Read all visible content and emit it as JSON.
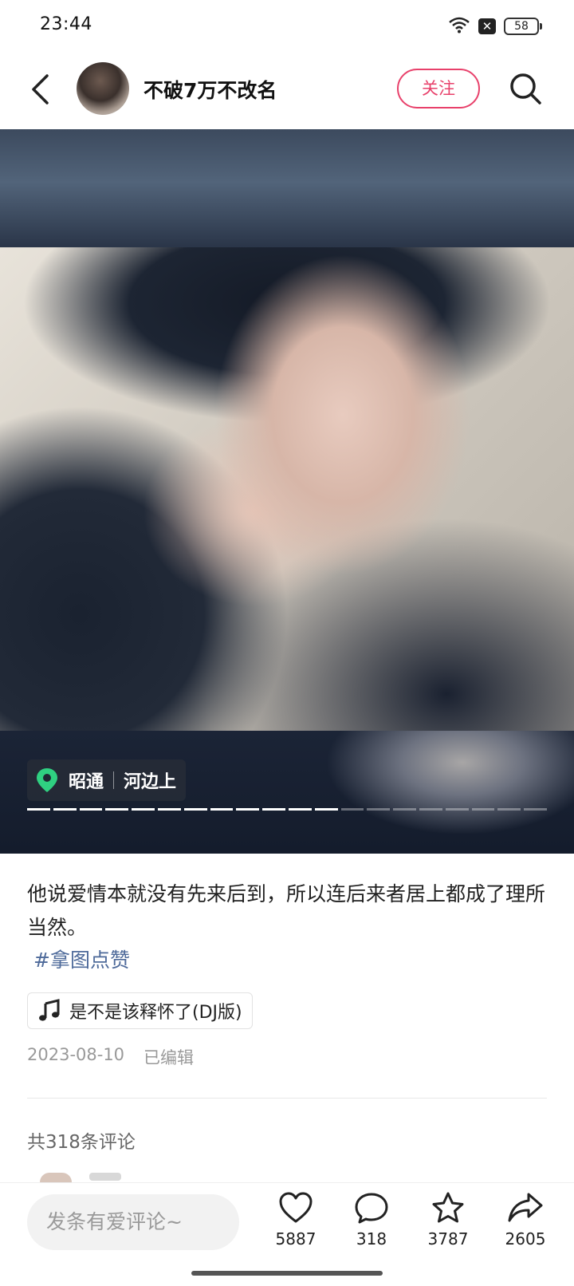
{
  "status_bar": {
    "time": "23:44",
    "battery": "58"
  },
  "header": {
    "username": "不破7万不改名",
    "follow_label": "关注"
  },
  "post": {
    "location_city": "昭通",
    "location_place": "河边上",
    "image_count": 20,
    "current_image_index": 12,
    "caption": "他说爱情本就没有先来后到，所以连后来者居上都成了理所当然。",
    "hashtag": "#拿图点赞",
    "music": "是不是该释怀了(DJ版)",
    "date": "2023-08-10",
    "edited_label": "已编辑",
    "comment_total": "共318条评论"
  },
  "bottom_bar": {
    "comment_placeholder": "发条有爱评论~",
    "likes": "5887",
    "comments": "318",
    "favorites": "3787",
    "shares": "2605"
  },
  "colors": {
    "accent": "#e8416b",
    "hashtag": "#4e6a9a",
    "location_pin": "#2fd081"
  },
  "icons": [
    "back-icon",
    "search-icon",
    "location-pin-icon",
    "music-note-icon",
    "heart-icon",
    "comment-icon",
    "star-icon",
    "share-icon",
    "wifi-icon"
  ]
}
